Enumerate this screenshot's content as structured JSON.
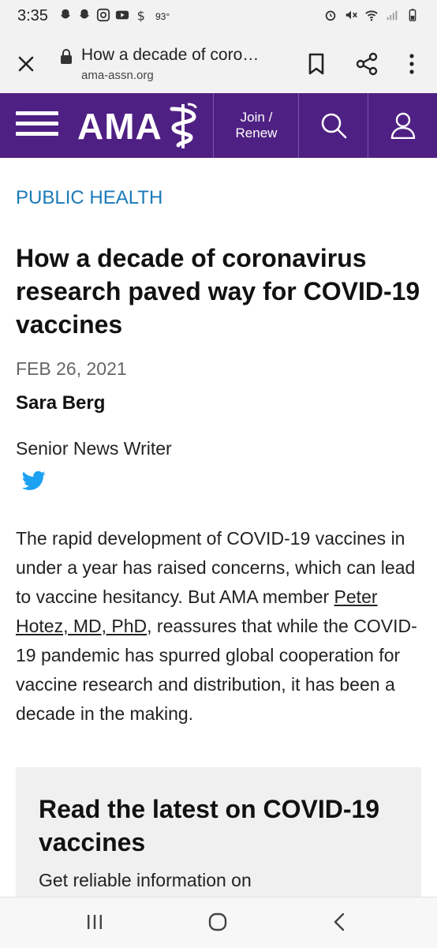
{
  "status_bar": {
    "time": "3:35",
    "temperature": "93°",
    "left_icons": [
      "snapchat-icon",
      "snapchat-icon",
      "instagram-icon",
      "youtube-icon",
      "dollar-icon"
    ],
    "right_icons": [
      "alarm-icon",
      "mute-icon",
      "wifi-icon",
      "signal-icon",
      "battery-icon"
    ]
  },
  "browser": {
    "page_title": "How a decade of coro…",
    "domain": "ama-assn.org"
  },
  "site_header": {
    "logo_text": "AMA",
    "join_label_line1": "Join /",
    "join_label_line2": "Renew",
    "brand_color": "#4f2083"
  },
  "article": {
    "category": "PUBLIC HEALTH",
    "title": "How a decade of coronavirus research paved way for COVID-19 vaccines",
    "date": "FEB 26, 2021",
    "author": "Sara Berg",
    "author_role": "Senior News Writer",
    "body_before_link": "The rapid development of COVID-19 vaccines in under a year has raised concerns, which can lead to vaccine hesitancy. But AMA member ",
    "body_link": "Peter Hotez, MD, PhD",
    "body_after_link": ", reassures that while the COVID-19 pandemic has spurred global cooperation for vaccine research and distribution, it has been a decade in the making."
  },
  "promo": {
    "title": "Read the latest on COVID-19 vaccines",
    "text": "Get reliable information on"
  },
  "accent_colors": {
    "category_link": "#1a7ab8",
    "twitter": "#1da1f2"
  }
}
